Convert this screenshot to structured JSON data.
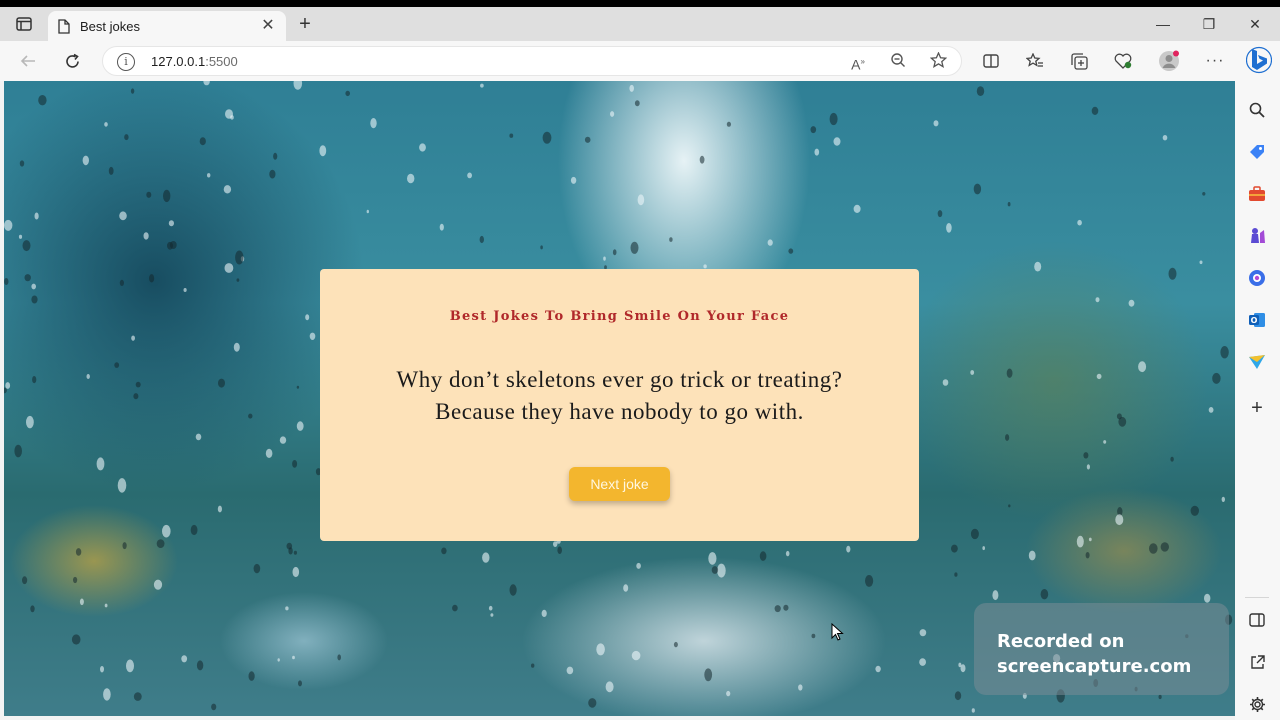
{
  "browser": {
    "tab": {
      "title": "Best jokes"
    },
    "address": {
      "host": "127.0.0.1",
      "port": ":5500"
    }
  },
  "page": {
    "heading": "Best Jokes To Bring Smile On Your Face",
    "joke_line1": "Why don’t skeletons ever go trick or treating?",
    "joke_line2": "Because they have nobody to go with.",
    "next_button": "Next joke"
  },
  "watermark": {
    "line1": "Recorded on",
    "line2": "screencapture.com"
  },
  "colors": {
    "card_bg": "#fde2b9",
    "heading": "#b0282a",
    "button_bg": "#f3b62e"
  },
  "icons": {
    "sidebar": [
      "search-icon",
      "tag-icon",
      "briefcase-icon",
      "chess-icon",
      "microsoft365-icon",
      "outlook-icon",
      "send-icon",
      "add-icon",
      "panel-icon",
      "external-link-icon",
      "gear-icon"
    ]
  }
}
